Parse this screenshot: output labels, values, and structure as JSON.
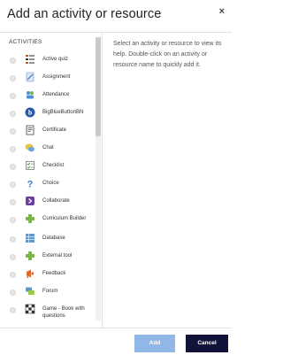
{
  "title": "Add an activity or resource",
  "close_glyph": "×",
  "section_label": "ACTIVITIES",
  "help_text": "Select an activity or resource to view its help. Double-click on an activity or resource name to quickly add it.",
  "items": [
    {
      "label": "Active quiz",
      "icon": "active-quiz-icon"
    },
    {
      "label": "Assignment",
      "icon": "assignment-icon"
    },
    {
      "label": "Attendance",
      "icon": "attendance-icon"
    },
    {
      "label": "BigBlueButtonBN",
      "icon": "bigbluebutton-icon"
    },
    {
      "label": "Certificate",
      "icon": "certificate-icon"
    },
    {
      "label": "Chat",
      "icon": "chat-icon"
    },
    {
      "label": "Checklist",
      "icon": "checklist-icon"
    },
    {
      "label": "Choice",
      "icon": "choice-icon"
    },
    {
      "label": "Collaborate",
      "icon": "collaborate-icon"
    },
    {
      "label": "Curriculum Builder",
      "icon": "curriculum-builder-icon"
    },
    {
      "label": "Database",
      "icon": "database-icon"
    },
    {
      "label": "External tool",
      "icon": "external-tool-icon"
    },
    {
      "label": "Feedback",
      "icon": "feedback-icon"
    },
    {
      "label": "Forum",
      "icon": "forum-icon"
    },
    {
      "label": "Game - Book with questions",
      "icon": "game-book-icon"
    }
  ],
  "buttons": {
    "add": "Add",
    "cancel": "Cancel"
  },
  "colors": {
    "add_button": "#8fb8e6",
    "cancel_button": "#12133b"
  }
}
